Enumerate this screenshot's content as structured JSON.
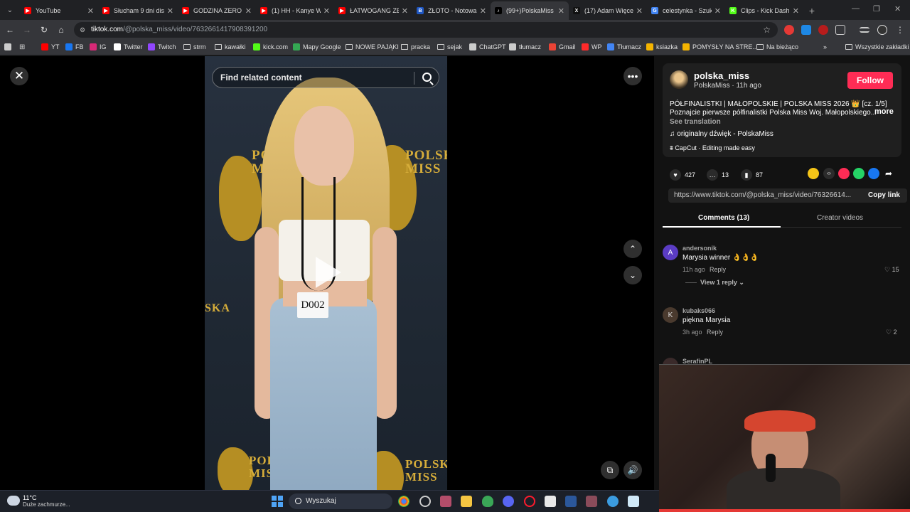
{
  "browser": {
    "tabs": [
      {
        "label": "YouTube",
        "color": "#ff0000",
        "glyph": "▶"
      },
      {
        "label": "Słucham 9 dni dis",
        "color": "#ff0000",
        "glyph": "▶"
      },
      {
        "label": "GODZINA ZERO #",
        "color": "#ff0000",
        "glyph": "▶"
      },
      {
        "label": "(1) HH - Kanye W",
        "color": "#ff0000",
        "glyph": "▶"
      },
      {
        "label": "ŁATWOGANG ZE",
        "color": "#ff0000",
        "glyph": "▶"
      },
      {
        "label": "ZŁOTO - Notowan",
        "color": "#1f57c3",
        "glyph": "B"
      },
      {
        "label": "(99+)PolskaMiss (",
        "color": "#000000",
        "glyph": "♪",
        "active": true
      },
      {
        "label": "(17) Adam Więcel",
        "color": "#111111",
        "glyph": "X"
      },
      {
        "label": "celestynka - Szuk",
        "color": "#4285f4",
        "glyph": "G"
      },
      {
        "label": "Clips - Kick Dashb",
        "color": "#53fc18",
        "glyph": "K"
      }
    ],
    "new_tab": "+",
    "url_host": "tiktok.com",
    "url_path": "/@polska_miss/video/7632661417908391200",
    "bookmarks": [
      {
        "label": "YT",
        "color": "#ff0000"
      },
      {
        "label": "FB",
        "color": "#1877f2"
      },
      {
        "label": "IG",
        "color": "#d62976"
      },
      {
        "label": "Twitter",
        "color": "#ffffff"
      },
      {
        "label": "Twitch",
        "color": "#9146ff"
      },
      {
        "label": "strm",
        "color": "folder"
      },
      {
        "label": "kawałki",
        "color": "folder"
      },
      {
        "label": "kick.com",
        "color": "#53fc18"
      },
      {
        "label": "Mapy Google",
        "color": "#34a853"
      },
      {
        "label": "NOWE PAJĄKI",
        "color": "folder"
      },
      {
        "label": "pracka",
        "color": "folder"
      },
      {
        "label": "sejak",
        "color": "folder"
      },
      {
        "label": "ChatGPT",
        "color": "#cccccc"
      },
      {
        "label": "tłumacz",
        "color": "#cccccc"
      },
      {
        "label": "Gmail",
        "color": "#ea4335"
      },
      {
        "label": "WP",
        "color": "#ff2a2a"
      },
      {
        "label": "Tłumacz",
        "color": "#4285f4"
      },
      {
        "label": "ksiazka",
        "color": "#f4b400"
      },
      {
        "label": "POMYSŁY NA STRE...",
        "color": "#f4b400"
      },
      {
        "label": "Na bieżąco",
        "color": "folder"
      }
    ],
    "bookmarks_overflow": "»",
    "all_bookmarks": "Wszystkie zakładki"
  },
  "player": {
    "search_placeholder": "Find related content",
    "video_text": {
      "left_logo": "POLSKA\nMISS",
      "right_logo": "POLSKA\nMISS",
      "side_text": "SKA",
      "tag": "D002",
      "bottom_left": "POLSKA\nMISS",
      "bottom_right": "POLSKA\nMISS"
    }
  },
  "post": {
    "username": "polska_miss",
    "display_name": "PolskaMiss",
    "time_ago": "11h ago",
    "follow_label": "Follow",
    "description_line1": "PÓŁFINALISTKI | MAŁOPOLSKIE | POLSKA MISS 2026 👑 [cz. 1/5]",
    "description_line2": "Poznajcie pierwsze półfinalistki Polska Miss Woj. Małopolskiego...",
    "more_label": "more",
    "see_translation": "See translation",
    "sound": "originalny dźwięk - PolskaMiss",
    "capcut": "CapCut · Editing made easy",
    "likes": "427",
    "comments_count": "13",
    "saves": "87",
    "link": "https://www.tiktok.com/@polska_miss/video/76326614...",
    "copy_link_label": "Copy link",
    "tab_comments": "Comments (13)",
    "tab_creator": "Creator videos"
  },
  "comments": [
    {
      "user": "andersonik",
      "text": "Marysia winner 👌👌👌",
      "time": "11h ago",
      "reply": "Reply",
      "likes": "15",
      "avatar": "A",
      "avatar_color": "#5b3cc4",
      "view_replies": "View 1 reply"
    },
    {
      "user": "kubaks066",
      "text": "piękna Marysia",
      "time": "3h ago",
      "reply": "Reply",
      "likes": "2",
      "avatar": "K",
      "avatar_color": "#4a3a2e"
    },
    {
      "user": "SerafinPL",
      "text": "",
      "time": "",
      "reply": "",
      "likes": "",
      "avatar": "",
      "avatar_color": "#3a2a2a"
    }
  ],
  "taskbar": {
    "temperature": "11°C",
    "weather": "Duże zachmurze...",
    "search_label": "Wyszukaj"
  }
}
